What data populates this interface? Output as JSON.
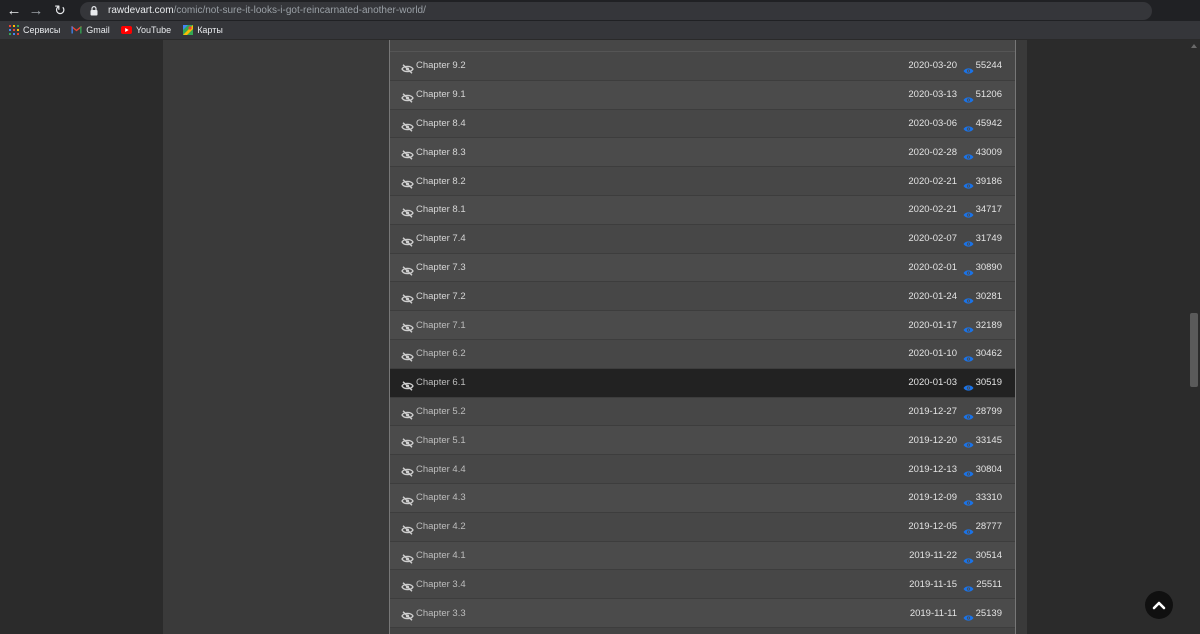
{
  "browser": {
    "url_host": "rawdevart.com",
    "url_path": "/comic/not-sure-it-looks-i-got-reincarnated-another-world/",
    "bookmarks": [
      {
        "label": "Сервисы",
        "icon": "apps-grid-icon"
      },
      {
        "label": "Gmail",
        "icon": "gmail-icon"
      },
      {
        "label": "YouTube",
        "icon": "youtube-icon"
      },
      {
        "label": "Карты",
        "icon": "maps-icon"
      }
    ]
  },
  "colors": {
    "view_icon": "#1a73e8",
    "active_row": "#222222"
  },
  "chapters": [
    {
      "title": "Chapter 9.2",
      "date": "2020-03-20",
      "views": "55244"
    },
    {
      "title": "Chapter 9.1",
      "date": "2020-03-13",
      "views": "51206"
    },
    {
      "title": "Chapter 8.4",
      "date": "2020-03-06",
      "views": "45942"
    },
    {
      "title": "Chapter 8.3",
      "date": "2020-02-28",
      "views": "43009"
    },
    {
      "title": "Chapter 8.2",
      "date": "2020-02-21",
      "views": "39186"
    },
    {
      "title": "Chapter 8.1",
      "date": "2020-02-21",
      "views": "34717"
    },
    {
      "title": "Chapter 7.4",
      "date": "2020-02-07",
      "views": "31749"
    },
    {
      "title": "Chapter 7.3",
      "date": "2020-02-01",
      "views": "30890"
    },
    {
      "title": "Chapter 7.2",
      "date": "2020-01-24",
      "views": "30281"
    },
    {
      "title": "Chapter 7.1",
      "date": "2020-01-17",
      "views": "32189"
    },
    {
      "title": "Chapter 6.2",
      "date": "2020-01-10",
      "views": "30462"
    },
    {
      "title": "Chapter 6.1",
      "date": "2020-01-03",
      "views": "30519"
    },
    {
      "title": "Chapter 5.2",
      "date": "2019-12-27",
      "views": "28799"
    },
    {
      "title": "Chapter 5.1",
      "date": "2019-12-20",
      "views": "33145"
    },
    {
      "title": "Chapter 4.4",
      "date": "2019-12-13",
      "views": "30804"
    },
    {
      "title": "Chapter 4.3",
      "date": "2019-12-09",
      "views": "33310"
    },
    {
      "title": "Chapter 4.2",
      "date": "2019-12-05",
      "views": "28777"
    },
    {
      "title": "Chapter 4.1",
      "date": "2019-11-22",
      "views": "30514"
    },
    {
      "title": "Chapter 3.4",
      "date": "2019-11-15",
      "views": "25511"
    },
    {
      "title": "Chapter 3.3",
      "date": "2019-11-11",
      "views": "25139"
    }
  ]
}
